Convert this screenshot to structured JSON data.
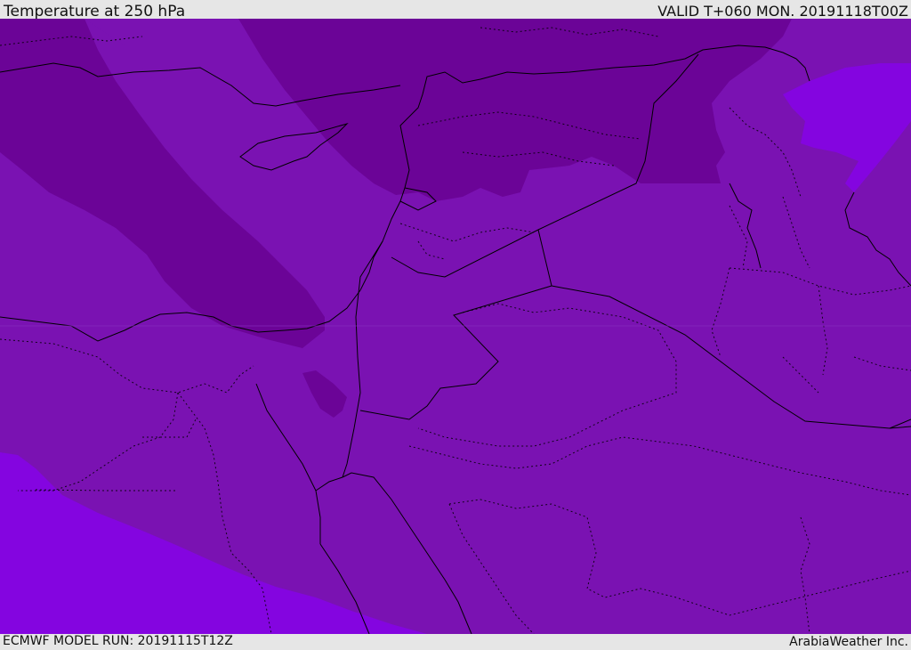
{
  "header": {
    "title": "Temperature at 250 hPa",
    "valid": "VALID T+060 MON. 20191118T00Z"
  },
  "footer": {
    "model_run": "ECMWF MODEL RUN: 20191115T12Z",
    "credit": "ArabiaWeather Inc."
  },
  "map": {
    "field": "temperature",
    "level": "250 hPa",
    "colors": {
      "base": "#7a12b2",
      "cold": "#6b0497",
      "warm": "#8405e0",
      "border": "#000000"
    }
  }
}
